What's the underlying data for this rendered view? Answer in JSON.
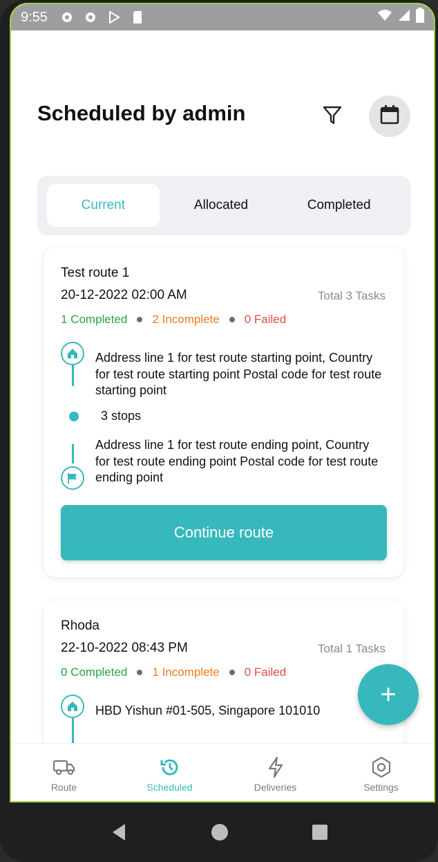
{
  "status_bar": {
    "time": "9:55",
    "icons": [
      "gear-icon",
      "gear-icon",
      "play-store-icon",
      "sd-card-icon",
      "wifi-icon",
      "signal-icon",
      "battery-icon"
    ]
  },
  "header": {
    "title": "Scheduled by admin",
    "filter_icon": "filter-icon",
    "calendar_icon": "calendar-icon"
  },
  "tabs": [
    {
      "label": "Current",
      "active": true
    },
    {
      "label": "Allocated",
      "active": false
    },
    {
      "label": "Completed",
      "active": false
    }
  ],
  "routes": [
    {
      "name": "Test route 1",
      "date": "20-12-2022 02:00 AM",
      "total_tasks": "Total 3 Tasks",
      "completed": "1 Completed",
      "incomplete": "2 Incomplete",
      "failed": "0 Failed",
      "start_address": "Address line 1 for test route starting point, Country for test route starting point Postal code for test route starting point",
      "stops": "3 stops",
      "end_address": "Address line 1 for test route ending point, Country for test route ending point Postal code for test route ending point",
      "action_label": "Continue route"
    },
    {
      "name": "Rhoda",
      "date": "22-10-2022 08:43 PM",
      "total_tasks": "Total 1 Tasks",
      "completed": "0 Completed",
      "incomplete": "1 Incomplete",
      "failed": "0 Failed",
      "start_address": "HBD Yishun #01-505, Singapore 101010"
    }
  ],
  "fab": {
    "label": "+"
  },
  "bottom_nav": [
    {
      "label": "Route",
      "icon": "truck-icon",
      "active": false
    },
    {
      "label": "Scheduled",
      "icon": "history-icon",
      "active": true
    },
    {
      "label": "Deliveries",
      "icon": "lightning-icon",
      "active": false
    },
    {
      "label": "Settings",
      "icon": "settings-hexagon-icon",
      "active": false
    }
  ],
  "colors": {
    "accent": "#36b8bd",
    "completed": "#27a64a",
    "incomplete": "#f07a1a",
    "failed": "#e24b4b"
  }
}
